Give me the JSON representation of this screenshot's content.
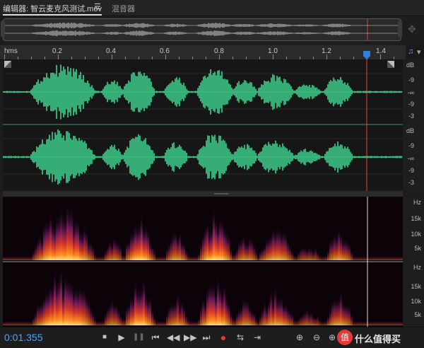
{
  "tabs": {
    "editor": "编辑器: 智云麦克风测试.mov",
    "menu_icon": "hamburger-icon",
    "mixer": "混音器"
  },
  "ruler": {
    "unit": "hms",
    "labels": [
      "0.2",
      "0.4",
      "0.6",
      "0.8",
      "1.0",
      "1.2",
      "1.4"
    ],
    "playhead_time": 1.355
  },
  "db_scale": {
    "track1": [
      "dB",
      "-9",
      "-∞",
      "-9",
      "-3"
    ],
    "track2": [
      "dB",
      "-9",
      "-∞",
      "-9",
      "-3"
    ]
  },
  "hz_scale": {
    "track1": [
      "Hz",
      "15k",
      "10k",
      "5k"
    ],
    "track2": [
      "Hz",
      "15k",
      "10k",
      "5k"
    ]
  },
  "transport": {
    "timecode": "0:01.355",
    "buttons": [
      "stop",
      "play",
      "pause",
      "go-to-start",
      "rewind",
      "fast-forward",
      "go-to-end",
      "record",
      "loop",
      "skip-selection"
    ],
    "zoom_buttons": [
      "zoom-in-amplitude",
      "zoom-out-amplitude",
      "zoom-in-time"
    ]
  },
  "watermark": {
    "text": "什么值得买",
    "logo_char": "值"
  },
  "colors": {
    "waveform": "#3fd28f",
    "playhead": "#e0463c",
    "timecode": "#4aa3ff",
    "record": "#e53935"
  }
}
